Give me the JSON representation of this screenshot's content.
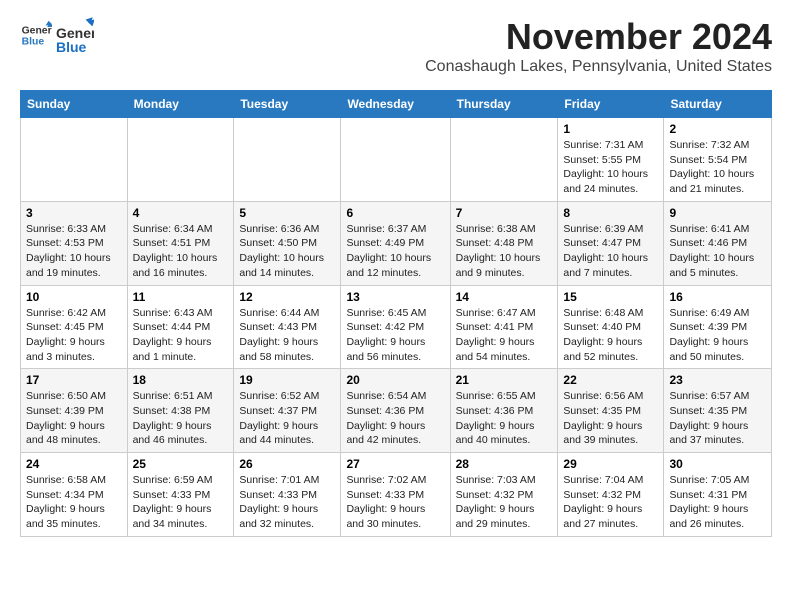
{
  "logo": {
    "line1": "General",
    "line2": "Blue"
  },
  "header": {
    "month_year": "November 2024",
    "location": "Conashaugh Lakes, Pennsylvania, United States"
  },
  "weekdays": [
    "Sunday",
    "Monday",
    "Tuesday",
    "Wednesday",
    "Thursday",
    "Friday",
    "Saturday"
  ],
  "weeks": [
    [
      {
        "day": "",
        "sunrise": "",
        "sunset": "",
        "daylight": ""
      },
      {
        "day": "",
        "sunrise": "",
        "sunset": "",
        "daylight": ""
      },
      {
        "day": "",
        "sunrise": "",
        "sunset": "",
        "daylight": ""
      },
      {
        "day": "",
        "sunrise": "",
        "sunset": "",
        "daylight": ""
      },
      {
        "day": "",
        "sunrise": "",
        "sunset": "",
        "daylight": ""
      },
      {
        "day": "1",
        "sunrise": "7:31 AM",
        "sunset": "5:55 PM",
        "daylight": "10 hours and 24 minutes."
      },
      {
        "day": "2",
        "sunrise": "7:32 AM",
        "sunset": "5:54 PM",
        "daylight": "10 hours and 21 minutes."
      }
    ],
    [
      {
        "day": "3",
        "sunrise": "6:33 AM",
        "sunset": "4:53 PM",
        "daylight": "10 hours and 19 minutes."
      },
      {
        "day": "4",
        "sunrise": "6:34 AM",
        "sunset": "4:51 PM",
        "daylight": "10 hours and 16 minutes."
      },
      {
        "day": "5",
        "sunrise": "6:36 AM",
        "sunset": "4:50 PM",
        "daylight": "10 hours and 14 minutes."
      },
      {
        "day": "6",
        "sunrise": "6:37 AM",
        "sunset": "4:49 PM",
        "daylight": "10 hours and 12 minutes."
      },
      {
        "day": "7",
        "sunrise": "6:38 AM",
        "sunset": "4:48 PM",
        "daylight": "10 hours and 9 minutes."
      },
      {
        "day": "8",
        "sunrise": "6:39 AM",
        "sunset": "4:47 PM",
        "daylight": "10 hours and 7 minutes."
      },
      {
        "day": "9",
        "sunrise": "6:41 AM",
        "sunset": "4:46 PM",
        "daylight": "10 hours and 5 minutes."
      }
    ],
    [
      {
        "day": "10",
        "sunrise": "6:42 AM",
        "sunset": "4:45 PM",
        "daylight": "9 hours and 3 minutes."
      },
      {
        "day": "11",
        "sunrise": "6:43 AM",
        "sunset": "4:44 PM",
        "daylight": "9 hours and 1 minute."
      },
      {
        "day": "12",
        "sunrise": "6:44 AM",
        "sunset": "4:43 PM",
        "daylight": "9 hours and 58 minutes."
      },
      {
        "day": "13",
        "sunrise": "6:45 AM",
        "sunset": "4:42 PM",
        "daylight": "9 hours and 56 minutes."
      },
      {
        "day": "14",
        "sunrise": "6:47 AM",
        "sunset": "4:41 PM",
        "daylight": "9 hours and 54 minutes."
      },
      {
        "day": "15",
        "sunrise": "6:48 AM",
        "sunset": "4:40 PM",
        "daylight": "9 hours and 52 minutes."
      },
      {
        "day": "16",
        "sunrise": "6:49 AM",
        "sunset": "4:39 PM",
        "daylight": "9 hours and 50 minutes."
      }
    ],
    [
      {
        "day": "17",
        "sunrise": "6:50 AM",
        "sunset": "4:39 PM",
        "daylight": "9 hours and 48 minutes."
      },
      {
        "day": "18",
        "sunrise": "6:51 AM",
        "sunset": "4:38 PM",
        "daylight": "9 hours and 46 minutes."
      },
      {
        "day": "19",
        "sunrise": "6:52 AM",
        "sunset": "4:37 PM",
        "daylight": "9 hours and 44 minutes."
      },
      {
        "day": "20",
        "sunrise": "6:54 AM",
        "sunset": "4:36 PM",
        "daylight": "9 hours and 42 minutes."
      },
      {
        "day": "21",
        "sunrise": "6:55 AM",
        "sunset": "4:36 PM",
        "daylight": "9 hours and 40 minutes."
      },
      {
        "day": "22",
        "sunrise": "6:56 AM",
        "sunset": "4:35 PM",
        "daylight": "9 hours and 39 minutes."
      },
      {
        "day": "23",
        "sunrise": "6:57 AM",
        "sunset": "4:35 PM",
        "daylight": "9 hours and 37 minutes."
      }
    ],
    [
      {
        "day": "24",
        "sunrise": "6:58 AM",
        "sunset": "4:34 PM",
        "daylight": "9 hours and 35 minutes."
      },
      {
        "day": "25",
        "sunrise": "6:59 AM",
        "sunset": "4:33 PM",
        "daylight": "9 hours and 34 minutes."
      },
      {
        "day": "26",
        "sunrise": "7:01 AM",
        "sunset": "4:33 PM",
        "daylight": "9 hours and 32 minutes."
      },
      {
        "day": "27",
        "sunrise": "7:02 AM",
        "sunset": "4:33 PM",
        "daylight": "9 hours and 30 minutes."
      },
      {
        "day": "28",
        "sunrise": "7:03 AM",
        "sunset": "4:32 PM",
        "daylight": "9 hours and 29 minutes."
      },
      {
        "day": "29",
        "sunrise": "7:04 AM",
        "sunset": "4:32 PM",
        "daylight": "9 hours and 27 minutes."
      },
      {
        "day": "30",
        "sunrise": "7:05 AM",
        "sunset": "4:31 PM",
        "daylight": "9 hours and 26 minutes."
      }
    ]
  ]
}
